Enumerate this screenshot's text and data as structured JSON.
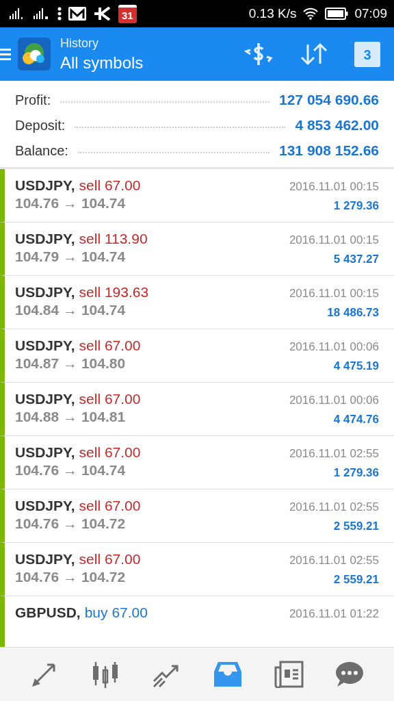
{
  "status_bar": {
    "calendar_day": "31",
    "speed": "0.13 K/s",
    "time": "07:09"
  },
  "header": {
    "title": "History",
    "subtitle": "All symbols",
    "calendar_badge": "3"
  },
  "summary": [
    {
      "label": "Profit:",
      "value": "127 054 690.66"
    },
    {
      "label": "Deposit:",
      "value": "4 853 462.00"
    },
    {
      "label": "Balance:",
      "value": "131 908 152.66"
    }
  ],
  "deals": [
    {
      "symbol": "USDJPY,",
      "side": "sell",
      "volume": "67.00",
      "color": "#c62828",
      "prices": "104.76 → 104.74",
      "time": "2016.11.01 00:15",
      "profit": "1 279.36"
    },
    {
      "symbol": "USDJPY,",
      "side": "sell",
      "volume": "113.90",
      "color": "#c62828",
      "prices": "104.79 → 104.74",
      "time": "2016.11.01 00:15",
      "profit": "5 437.27"
    },
    {
      "symbol": "USDJPY,",
      "side": "sell",
      "volume": "193.63",
      "color": "#c62828",
      "prices": "104.84 → 104.74",
      "time": "2016.11.01 00:15",
      "profit": "18 486.73"
    },
    {
      "symbol": "USDJPY,",
      "side": "sell",
      "volume": "67.00",
      "color": "#c62828",
      "prices": "104.87 → 104.80",
      "time": "2016.11.01 00:06",
      "profit": "4 475.19"
    },
    {
      "symbol": "USDJPY,",
      "side": "sell",
      "volume": "67.00",
      "color": "#c62828",
      "prices": "104.88 → 104.81",
      "time": "2016.11.01 00:06",
      "profit": "4 474.76"
    },
    {
      "symbol": "USDJPY,",
      "side": "sell",
      "volume": "67.00",
      "color": "#c62828",
      "prices": "104.76 → 104.74",
      "time": "2016.11.01 02:55",
      "profit": "1 279.36"
    },
    {
      "symbol": "USDJPY,",
      "side": "sell",
      "volume": "67.00",
      "color": "#c62828",
      "prices": "104.76 → 104.72",
      "time": "2016.11.01 02:55",
      "profit": "2 559.21"
    },
    {
      "symbol": "USDJPY,",
      "side": "sell",
      "volume": "67.00",
      "color": "#c62828",
      "prices": "104.76 → 104.72",
      "time": "2016.11.01 02:55",
      "profit": "2 559.21"
    },
    {
      "symbol": "GBPUSD,",
      "side": "buy",
      "volume": "67.00",
      "color": "#1976d2",
      "time": "2016.11.01 01:22"
    }
  ],
  "nav": [
    {
      "kind": "trade",
      "selected": false
    },
    {
      "kind": "chart",
      "selected": false
    },
    {
      "kind": "quotes",
      "selected": false
    },
    {
      "kind": "history",
      "selected": true
    },
    {
      "kind": "news",
      "selected": false
    },
    {
      "kind": "chat",
      "selected": false
    }
  ]
}
